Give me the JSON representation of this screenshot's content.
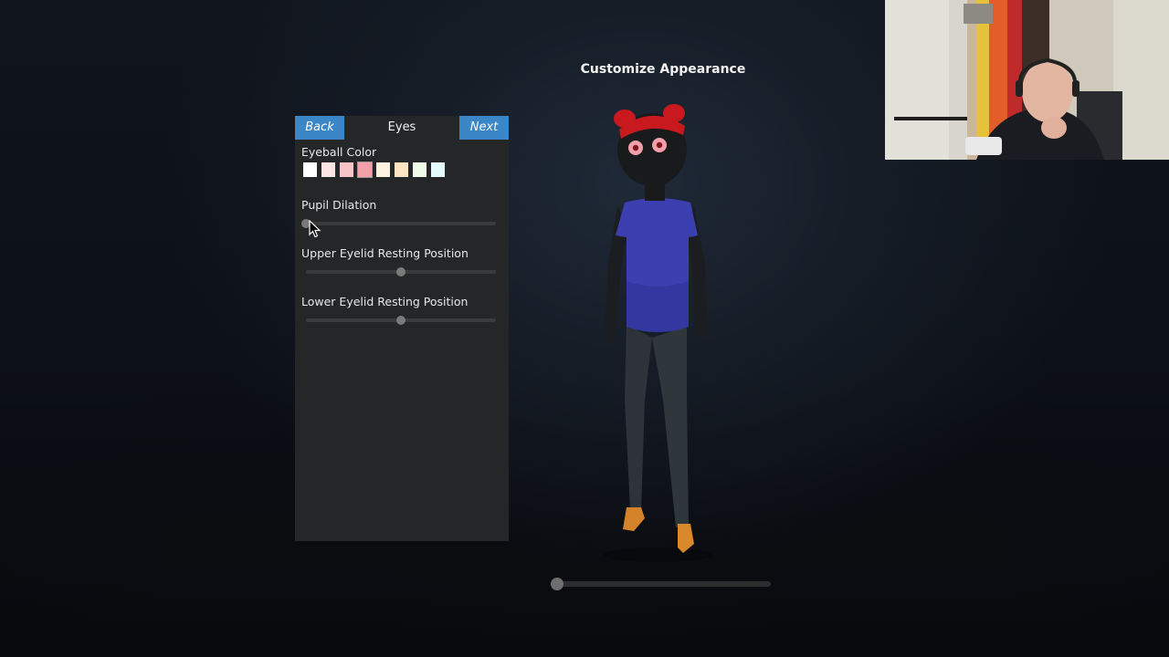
{
  "screen": {
    "title": "Customize Appearance"
  },
  "panel": {
    "back_label": "Back",
    "title": "Eyes",
    "next_label": "Next",
    "eyeball_color": {
      "label": "Eyeball Color",
      "swatches": [
        "#ffffff",
        "#fde3e3",
        "#f8c4c8",
        "#f4a0a8",
        "#fdf1e2",
        "#fde5c4",
        "#eefbe8",
        "#e6f9fb"
      ],
      "selected_index": 3
    },
    "pupil_dilation": {
      "label": "Pupil Dilation",
      "value_percent": 0
    },
    "upper_eyelid": {
      "label": "Upper Eyelid Resting Position",
      "value_percent": 50
    },
    "lower_eyelid": {
      "label": "Lower Eyelid Resting Position",
      "value_percent": 50
    }
  },
  "rotation_slider": {
    "value_percent": 3
  },
  "colors": {
    "button_blue": "#3a86c7",
    "panel_bg": "#252627",
    "hat_red": "#c8191e",
    "shirt_blue": "#3b3fb0",
    "pants_gray": "#2d3338",
    "skin": "#191a1c",
    "shoes_orange": "#d4832a"
  },
  "icons": {
    "cursor": "mouse-pointer-icon"
  }
}
